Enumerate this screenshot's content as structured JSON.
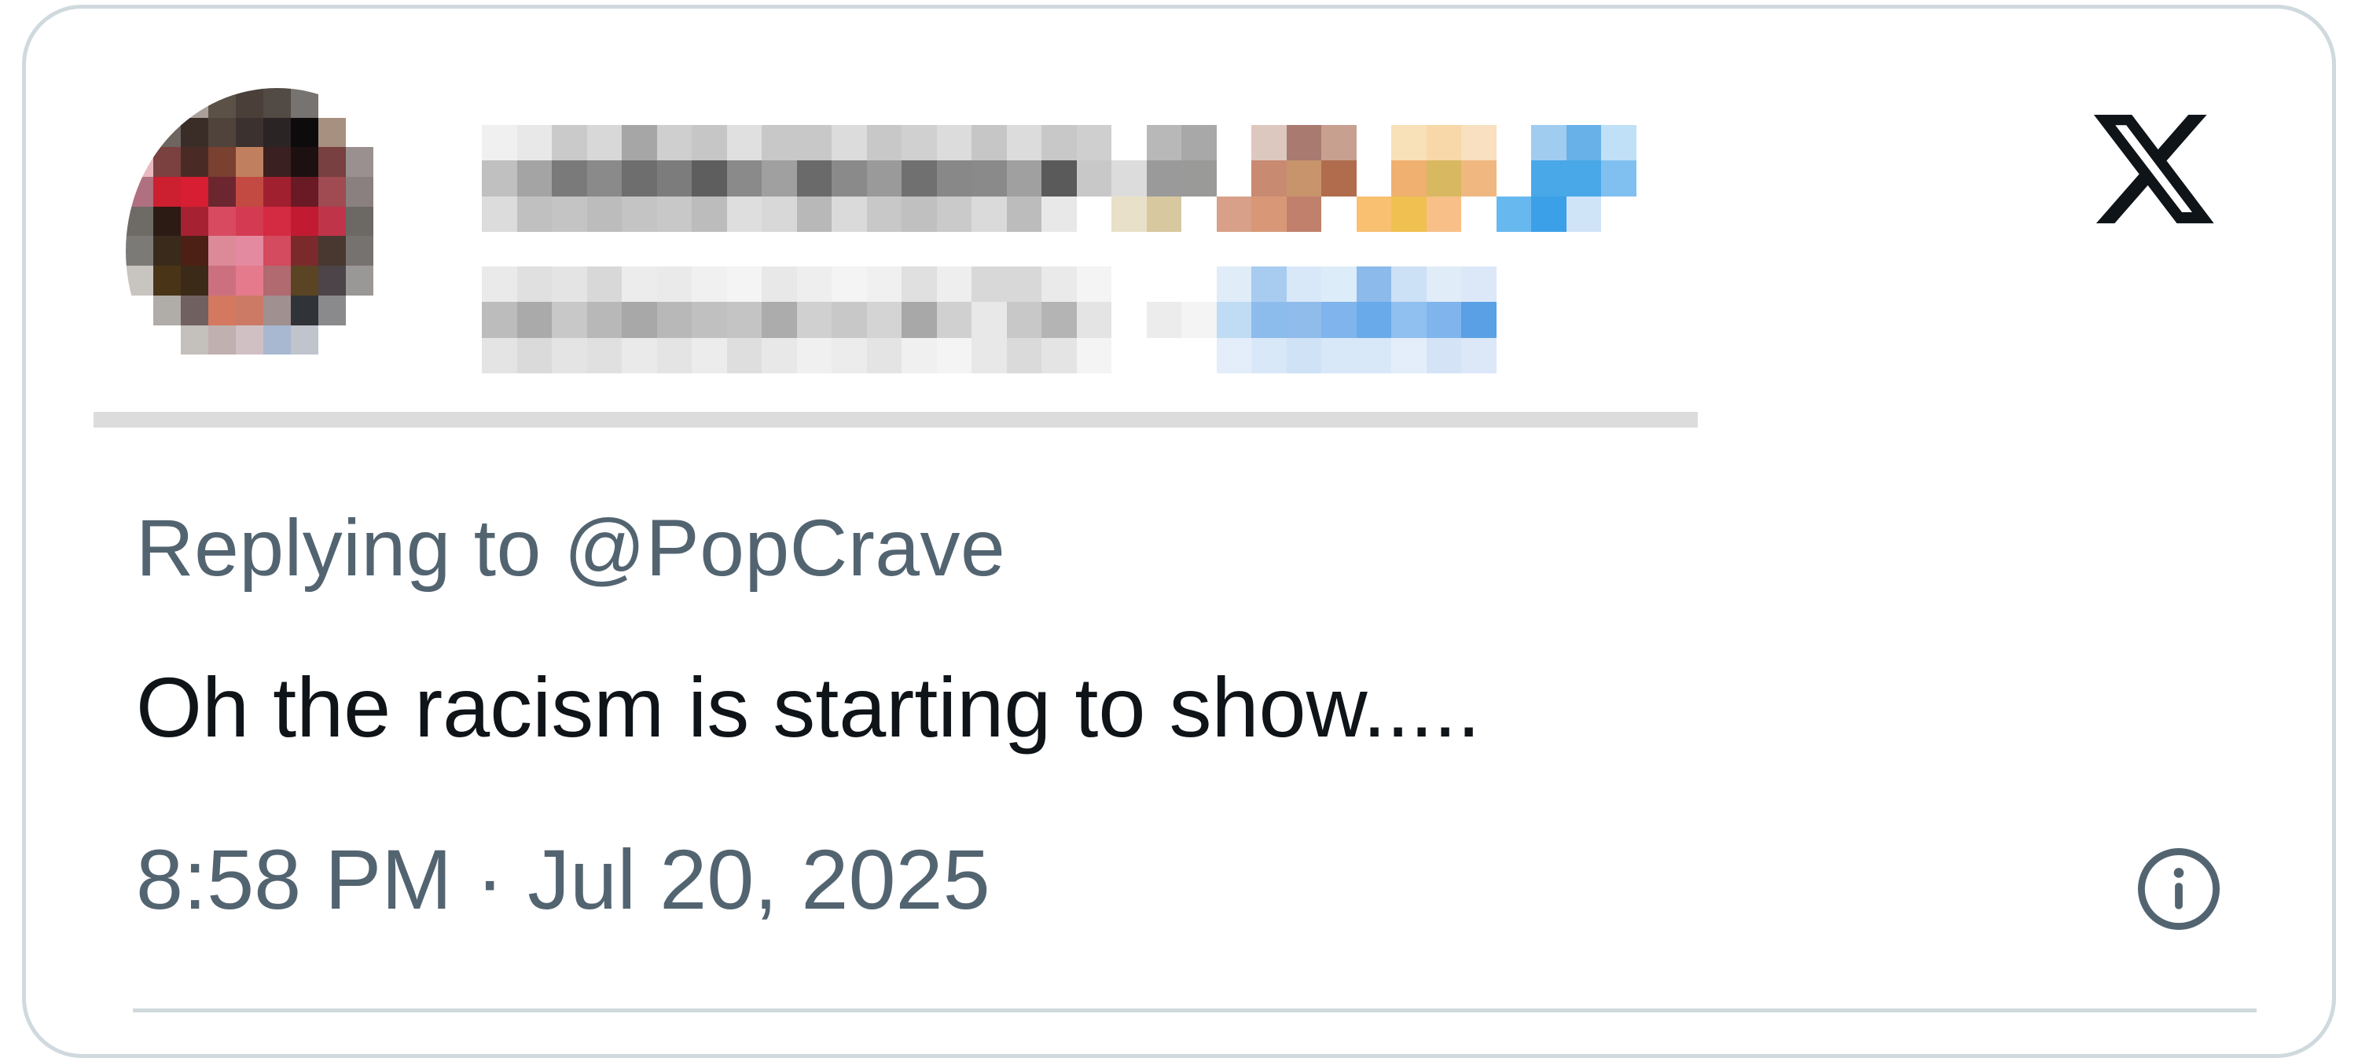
{
  "tweet": {
    "reply_prefix": "Replying to ",
    "reply_handle": "@PopCrave",
    "text": "Oh the racism is starting to show.....",
    "timestamp": "8:58 PM · Jul 20, 2025"
  },
  "icons": {
    "brand": "x-logo-icon",
    "info": "info-icon"
  },
  "colors": {
    "text_primary": "#0f1419",
    "text_secondary": "#536471",
    "border": "#cfd9de"
  },
  "pixelated": {
    "avatar": [
      "#ffffff",
      "#ffffff",
      "#a9a199",
      "#5b5146",
      "#4a4039",
      "#524a44",
      "#777370",
      "#ffffff",
      "#ffffff",
      "#ffffff",
      "#ffffff",
      "#ffffff",
      "#6e6560",
      "#3a2d28",
      "#50433c",
      "#3b312e",
      "#2a2424",
      "#0d0b0c",
      "#a89080",
      "#ffffff",
      "#ffffff",
      "#ffffff",
      "#e8b9c0",
      "#7b4040",
      "#4a2a24",
      "#7a4030",
      "#c08060",
      "#3a2020",
      "#1c1010",
      "#784040",
      "#9a9090",
      "#ffffff",
      "#ffffff",
      "#b07080",
      "#cc1f2f",
      "#d81e32",
      "#6c2630",
      "#c34a42",
      "#a02030",
      "#6a1a24",
      "#a04a52",
      "#8a8080",
      "#ffffff",
      "#ffffff",
      "#6e6a66",
      "#2c1a14",
      "#a62232",
      "#d84a60",
      "#d43a52",
      "#d42a42",
      "#c21a32",
      "#c0344a",
      "#6c6864",
      "#ffffff",
      "#ffffff",
      "#7c7a76",
      "#3a2a1c",
      "#4c2014",
      "#dc8a98",
      "#e48aa0",
      "#d44a5e",
      "#7a2a2a",
      "#483830",
      "#767270",
      "#ffffff",
      "#ffffff",
      "#c8c4c0",
      "#4a3418",
      "#3c2a18",
      "#cc7080",
      "#e47a8c",
      "#b06a70",
      "#5a4424",
      "#4c4448",
      "#9a9896",
      "#ffffff",
      "#ffffff",
      "#ffffff",
      "#b0aca8",
      "#706060",
      "#d47860",
      "#cc7a66",
      "#a09090",
      "#303438",
      "#8a8a8c",
      "#ffffff",
      "#ffffff",
      "#ffffff",
      "#ffffff",
      "#ffffff",
      "#c4c0bc",
      "#c0b0b0",
      "#d0c0c4",
      "#a8b8d0",
      "#c0c4cc",
      "#ffffff",
      "#ffffff",
      "#ffffff",
      "#ffffff",
      "#ffffff",
      "#ffffff",
      "#ffffff",
      "#ffffff",
      "#ffffff",
      "#ffffff",
      "#ffffff",
      "#ffffff",
      "#ffffff",
      "#ffffff",
      "#ffffff",
      "#ffffff",
      "#ffffff",
      "#ffffff",
      "#ffffff",
      "#ffffff",
      "#ffffff",
      "#ffffff",
      "#ffffff",
      "#ffffff",
      "#ffffff",
      "#ffffff"
    ],
    "name_row": [
      "#f0f0f0",
      "#e8e8e8",
      "#cacaca",
      "#d8d8d8",
      "#a6a6a6",
      "#cfcfcf",
      "#c6c6c6",
      "#e0e0e0",
      "#c8c8c8",
      "#c8c8c8",
      "#dcdcdc",
      "#c8c8c8",
      "#d0d0d0",
      "#dcdcdc",
      "#c6c6c6",
      "#dcdcdc",
      "#c8c8c8",
      "#cfcfcf",
      "#ffffff",
      "#b8b8b8",
      "#a8a8a8",
      "#ffffff",
      "#ddc8c0",
      "#a87a70",
      "#c8a090",
      "#ffffff",
      "#f8e0b8",
      "#f8d8a8",
      "#f8e0c0",
      "#ffffff",
      "#a0ccf0",
      "#68b0e8",
      "#c0e0f8",
      "#c0c0c0",
      "#a4a4a4",
      "#7a7a7a",
      "#8a8a8a",
      "#6e6e6e",
      "#7c7c7c",
      "#5e5e5e",
      "#8a8a8a",
      "#a0a0a0",
      "#6a6a6a",
      "#8a8a8a",
      "#9a9a9a",
      "#707070",
      "#888888",
      "#8a8a8a",
      "#a0a0a0",
      "#5a5a5a",
      "#c8c8c8",
      "#dcdcdc",
      "#9a9a9a",
      "#9a9a98",
      "#ffffff",
      "#c88a70",
      "#c8946c",
      "#b06c4c",
      "#ffffff",
      "#f0b070",
      "#d8b860",
      "#f0b880",
      "#ffffff",
      "#48a8e8",
      "#48a8e8",
      "#80c0f0",
      "#dcdcdc",
      "#c0c0c0",
      "#c4c4c4",
      "#bcbcbc",
      "#c4c4c4",
      "#c8c8c8",
      "#bcbcbc",
      "#dedede",
      "#d8d8d8",
      "#b8b8b8",
      "#dadada",
      "#c8c8c8",
      "#c0c0c0",
      "#cacaca",
      "#dadada",
      "#bcbcbc",
      "#e8e8e8",
      "#ffffff",
      "#e8e0c8",
      "#d8c8a0",
      "#ffffff",
      "#d8a088",
      "#d89878",
      "#c0806c",
      "#ffffff",
      "#f8c070",
      "#f0c050",
      "#f8c088",
      "#ffffff",
      "#68b8f0",
      "#3ca0e8",
      "#d0e4f8"
    ],
    "handle_row": [
      "#eaeaea",
      "#e0e0e0",
      "#e4e4e4",
      "#d8d8d8",
      "#ececec",
      "#eaeaea",
      "#f0f0f0",
      "#f4f4f4",
      "#e8e8e8",
      "#eeeeee",
      "#f4f4f4",
      "#f0f0f0",
      "#e0e0e0",
      "#eeeeee",
      "#d8d8d8",
      "#d8d8d8",
      "#eaeaea",
      "#f4f4f4",
      "#ffffff",
      "#ffffff",
      "#ffffff",
      "#e0ecf8",
      "#a8ccf0",
      "#d8e8f8",
      "#dcecf8",
      "#8cbaea",
      "#cce0f6",
      "#e0ecf8",
      "#dce8f8",
      "#ffffff",
      "#ffffff",
      "#bcbcbc",
      "#aaaaaa",
      "#c8c8c8",
      "#b8b8b8",
      "#a8a8a8",
      "#b8b8b8",
      "#c0c0c0",
      "#c4c4c4",
      "#acacac",
      "#d0d0d0",
      "#c8c8c8",
      "#d4d4d4",
      "#a8a8a8",
      "#d0d0d0",
      "#e8e8e8",
      "#c8c8c8",
      "#b4b4b4",
      "#e4e4e4",
      "#ffffff",
      "#ececec",
      "#f4f4f4",
      "#c0dcf4",
      "#8cbcec",
      "#90bcec",
      "#80b4ec",
      "#68aaea",
      "#90c0f0",
      "#80b4ec",
      "#5aa0e4",
      "#ffffff",
      "#ffffff",
      "#e4e4e4",
      "#dadada",
      "#e4e4e4",
      "#e0e0e0",
      "#eaeaea",
      "#e4e4e4",
      "#ececec",
      "#dedede",
      "#e8e8e8",
      "#f0f0f0",
      "#ececec",
      "#e4e4e4",
      "#f0f0f0",
      "#f4f4f4",
      "#e8e8e8",
      "#dadada",
      "#e4e4e4",
      "#f4f4f4",
      "#ffffff",
      "#ffffff",
      "#ffffff",
      "#e4eefa",
      "#d8e8f8",
      "#cfe2f6",
      "#d8e8f8",
      "#d8e8f8",
      "#e4eefa",
      "#d4e4f6",
      "#dce8f8",
      "#ffffff",
      "#ffffff"
    ]
  }
}
